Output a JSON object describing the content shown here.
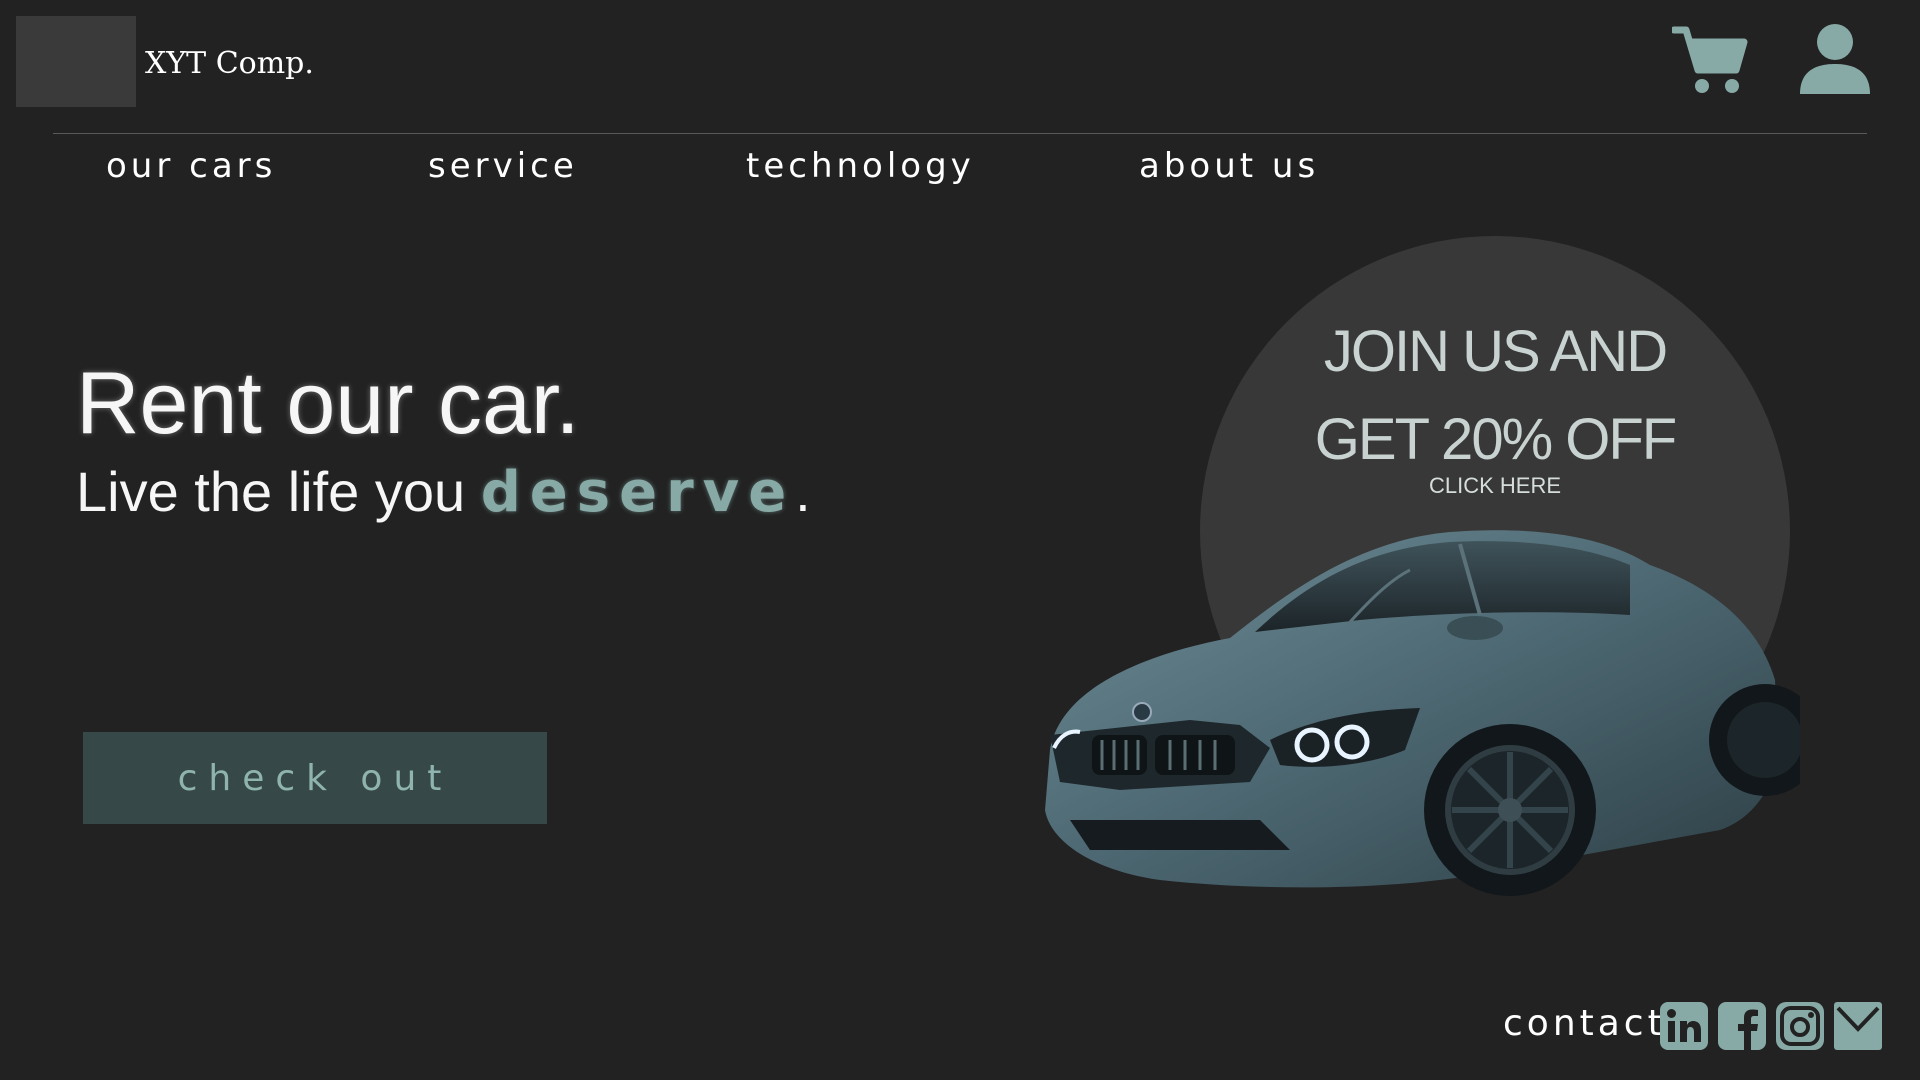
{
  "header": {
    "company_name": "XYT Comp.",
    "icons": [
      "cart-icon",
      "user-icon"
    ]
  },
  "nav": {
    "items": [
      {
        "label": "our cars"
      },
      {
        "label": "service"
      },
      {
        "label": "technology"
      },
      {
        "label": "about us"
      }
    ]
  },
  "hero": {
    "title": "Rent our car.",
    "subtitle_prefix": "Live the life you ",
    "subtitle_accent": "deserve",
    "subtitle_suffix": ".",
    "cta_label": "check out"
  },
  "promo": {
    "line1": "JOIN US AND",
    "line2": "GET  20% OFF",
    "line3": "CLICK HERE"
  },
  "footer": {
    "contact_label": "contact",
    "social_icons": [
      "linkedin-icon",
      "facebook-icon",
      "instagram-icon",
      "mail-icon"
    ]
  },
  "colors": {
    "background": "#222222",
    "accent": "#87aaa6",
    "button_bg": "#364948",
    "circle": "#383838"
  }
}
